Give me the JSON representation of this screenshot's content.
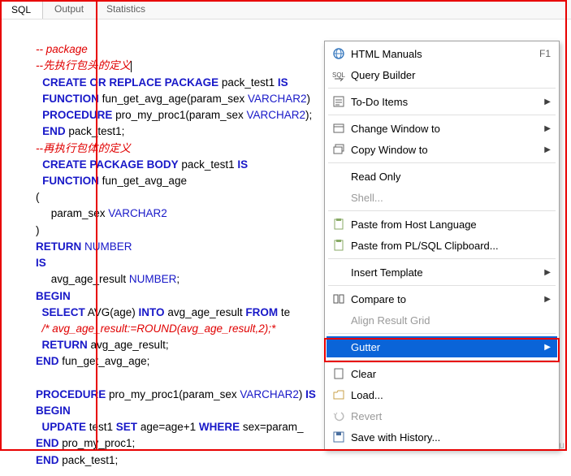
{
  "tabs": {
    "sql": "SQL",
    "output": "Output",
    "statistics": "Statistics"
  },
  "code": {
    "l1": "-- package",
    "l2": "--先执行包头的定义",
    "l3a": "CREATE OR REPLACE PACKAGE",
    "l3b": " pack_test1 ",
    "l3c": "IS",
    "l4a": "FUNCTION",
    "l4b": " fun_get_avg_age(param_sex ",
    "l4c": "VARCHAR2",
    "l4d": ")",
    "l5a": "PROCEDURE",
    "l5b": " pro_my_proc1(param_sex ",
    "l5c": "VARCHAR2",
    "l5d": ");",
    "l6a": "END",
    "l6b": " pack_test1;",
    "l7": "--再执行包体的定义",
    "l8a": "CREATE PACKAGE BODY",
    "l8b": " pack_test1 ",
    "l8c": "IS",
    "l9a": "FUNCTION",
    "l9b": " fun_get_avg_age",
    "l10": "(",
    "l11a": "     param_sex ",
    "l11b": "VARCHAR2",
    "l12": ")",
    "l13a": "RETURN",
    "l13b": " NUMBER",
    "l14": "IS",
    "l15a": "     avg_age_result ",
    "l15b": "NUMBER",
    "l15c": ";",
    "l16": "BEGIN",
    "l17a": "  SELECT",
    "l17b": " AVG(age) ",
    "l17c": "INTO",
    "l17d": " avg_age_result ",
    "l17e": "FROM",
    "l17f": " te",
    "l18": "  /* avg_age_result:=ROUND(avg_age_result,2);*",
    "l19a": "  RETURN",
    "l19b": " avg_age_result;",
    "l20a": "END",
    "l20b": " fun_get_avg_age;",
    "l21": "",
    "l22a": "PROCEDURE",
    "l22b": " pro_my_proc1(param_sex ",
    "l22c": "VARCHAR2",
    "l22d": ") ",
    "l22e": "IS",
    "l23": "BEGIN",
    "l24a": "  UPDATE",
    "l24b": " test1 ",
    "l24c": "SET",
    "l24d": " age=age+1 ",
    "l24e": "WHERE",
    "l24f": " sex=param_",
    "l25a": "END",
    "l25b": " pro_my_proc1;",
    "l26a": "END",
    "l26b": " pack_test1;"
  },
  "menu": {
    "html_manuals": "HTML Manuals",
    "html_sh": "F1",
    "query_builder": "Query Builder",
    "todo": "To-Do Items",
    "change_window": "Change Window to",
    "copy_window": "Copy Window to",
    "read_only": "Read Only",
    "shell": "Shell...",
    "paste_host": "Paste from Host Language",
    "paste_plsql": "Paste from PL/SQL Clipboard...",
    "insert_template": "Insert Template",
    "compare": "Compare to",
    "align": "Align Result Grid",
    "gutter": "Gutter",
    "clear": "Clear",
    "load": "Load...",
    "revert": "Revert",
    "save_history": "Save with History..."
  },
  "watermark": "CSDN @alpha_xu"
}
